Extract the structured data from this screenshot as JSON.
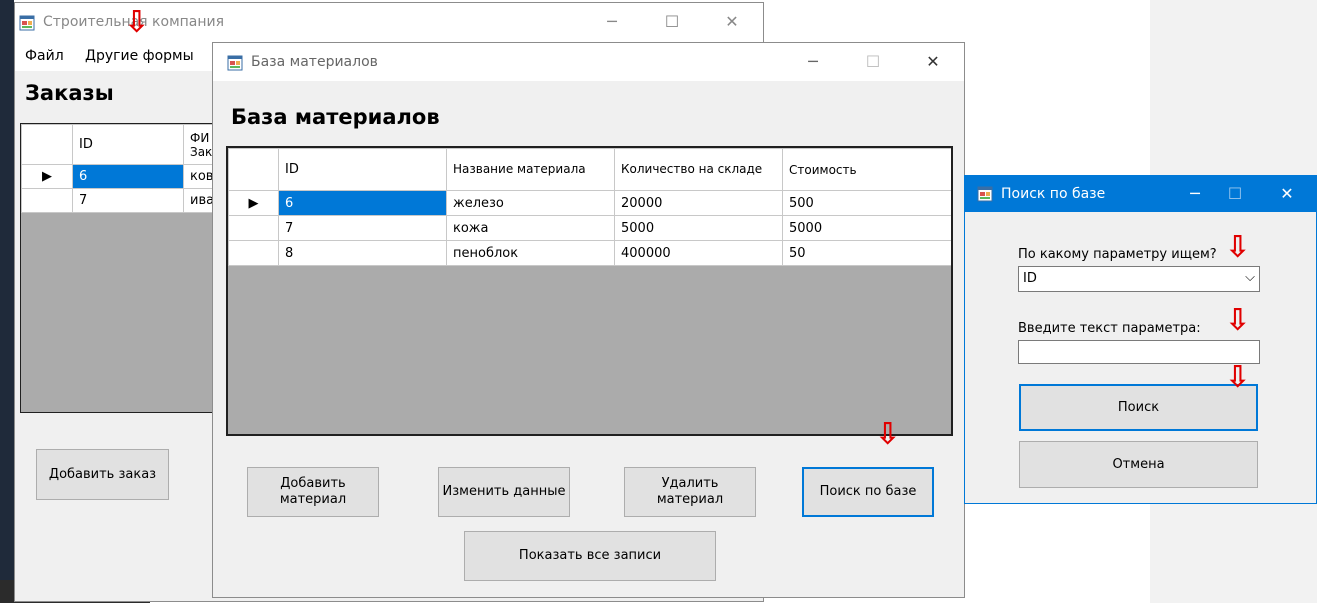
{
  "main_window": {
    "title": "Строительная компания",
    "menu": [
      "Файл",
      "Другие формы"
    ],
    "heading": "Заказы",
    "grid": {
      "headers": [
        "ID",
        "ФИ Зак"
      ],
      "rows": [
        [
          "6",
          "кова"
        ],
        [
          "7",
          "иван"
        ]
      ]
    },
    "add_order_label": "Добавить заказ"
  },
  "materials_window": {
    "title": "База материалов",
    "heading": "База материалов",
    "grid": {
      "headers": [
        "ID",
        "Название материала",
        "Количество на складе",
        "Стоимость"
      ],
      "rows": [
        [
          "6",
          "железо",
          "20000",
          "500"
        ],
        [
          "7",
          "кожа",
          "5000",
          "5000"
        ],
        [
          "8",
          "пеноблок",
          "400000",
          "50"
        ]
      ]
    },
    "buttons": {
      "add": "Добавить материал",
      "edit": "Изменить данные",
      "delete": "Удалить материал",
      "search": "Поиск по базе",
      "show_all": "Показать все записи"
    }
  },
  "search_window": {
    "title": "Поиск по базе",
    "param_label": "По какому параметру ищем?",
    "param_value": "ID",
    "text_label": "Введите текст параметра:",
    "text_value": "",
    "search_label": "Поиск",
    "cancel_label": "Отмена"
  },
  "colors": {
    "selection": "#0078d7",
    "annotation_arrow": "#e00000"
  },
  "icons": {
    "window_icon": "app-form-icon",
    "annotation": "red-down-arrow-icon"
  }
}
